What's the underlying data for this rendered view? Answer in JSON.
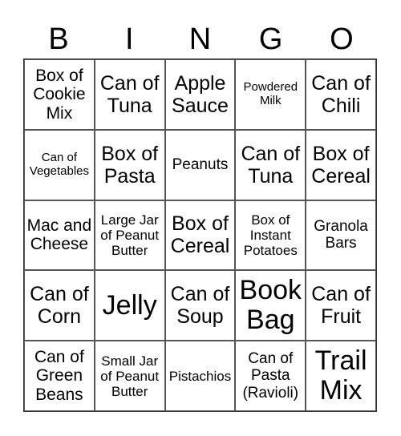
{
  "header": {
    "letters": [
      "B",
      "I",
      "N",
      "G",
      "O"
    ]
  },
  "cells": [
    "Box of Cookie Mix",
    "Can of Tuna",
    "Apple Sauce",
    "Powdered Milk",
    "Can of Chili",
    "Can of Vegetables",
    "Box of Pasta",
    "Peanuts",
    "Can of Tuna",
    "Box of Cereal",
    "Mac and Cheese",
    "Large Jar of Peanut Butter",
    "Box of Cereal",
    "Box of Instant Potatoes",
    "Granola Bars",
    "Can of Corn",
    "Jelly",
    "Can of Soup",
    "Book Bag",
    "Can of Fruit",
    "Can of Green Beans",
    "Small Jar of Peanut Butter",
    "Pistachios",
    "Can of Pasta (Ravioli)",
    "Trail Mix"
  ]
}
